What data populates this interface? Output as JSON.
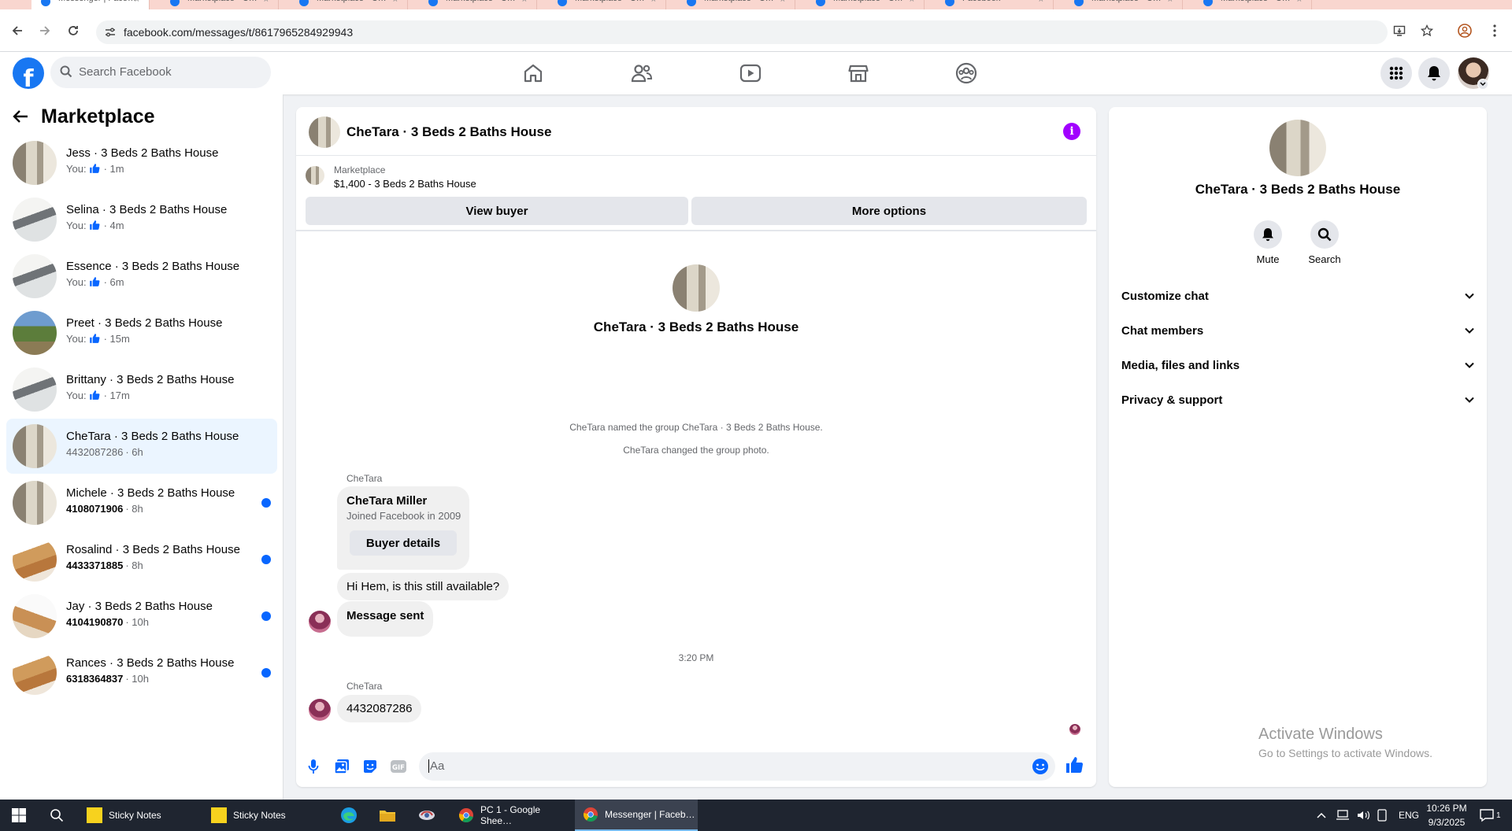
{
  "browser": {
    "tabs": [
      "Messenger | Face…",
      "Marketplace - C…",
      "Marketplace - C…",
      "Marketplace - C…",
      "Marketplace - C…",
      "Marketplace - C…",
      "Marketplace - C…",
      "Facebook",
      "Marketplace - C…",
      "Marketplace - C…"
    ],
    "url": "facebook.com/messages/t/8617965284929943"
  },
  "fb": {
    "search_placeholder": "Search Facebook",
    "brand_color": "#1877f2"
  },
  "sidebar": {
    "title": "Marketplace",
    "conversations": [
      {
        "name": "Jess · 3 Beds 2 Baths House",
        "prefix": "You:",
        "time": "· 1m",
        "liked": true,
        "unread": false,
        "active": false,
        "thumb": "thumb-a"
      },
      {
        "name": "Selina · 3 Beds 2 Baths House",
        "prefix": "You:",
        "time": "· 4m",
        "liked": true,
        "unread": false,
        "active": false,
        "thumb": "thumb-b"
      },
      {
        "name": "Essence · 3 Beds 2 Baths House",
        "prefix": "You:",
        "time": "· 6m",
        "liked": true,
        "unread": false,
        "active": false,
        "thumb": "thumb-b"
      },
      {
        "name": "Preet · 3 Beds 2 Baths House",
        "prefix": "You:",
        "time": "· 15m",
        "liked": true,
        "unread": false,
        "active": false,
        "thumb": "thumb-c"
      },
      {
        "name": "Brittany · 3 Beds 2 Baths House",
        "prefix": "You:",
        "time": "· 17m",
        "liked": true,
        "unread": false,
        "active": false,
        "thumb": "thumb-b"
      },
      {
        "name": "CheTara · 3 Beds 2 Baths House",
        "prefix": "4432087286",
        "time": "· 6h",
        "liked": false,
        "unread": false,
        "active": true,
        "thumb": "thumb-a"
      },
      {
        "name": "Michele · 3 Beds 2 Baths House",
        "prefix": "4108071906",
        "time": "· 8h",
        "liked": false,
        "unread": true,
        "active": false,
        "thumb": "thumb-a"
      },
      {
        "name": "Rosalind · 3 Beds 2 Baths House",
        "prefix": "4433371885",
        "time": "· 8h",
        "liked": false,
        "unread": true,
        "active": false,
        "thumb": "thumb-d"
      },
      {
        "name": "Jay · 3 Beds 2 Baths House",
        "prefix": "4104190870",
        "time": "· 10h",
        "liked": false,
        "unread": true,
        "active": false,
        "thumb": "thumb-e"
      },
      {
        "name": "Rances · 3 Beds 2 Baths House",
        "prefix": "6318364837",
        "time": "· 10h",
        "liked": false,
        "unread": true,
        "active": false,
        "thumb": "thumb-d"
      }
    ]
  },
  "chat": {
    "title": "CheTara · 3 Beds 2 Baths House",
    "listing_source": "Marketplace",
    "listing_title": "$1,400 - 3 Beds 2 Baths House",
    "view_buyer_label": "View buyer",
    "more_options_label": "More options",
    "hero_name": "CheTara · 3 Beds 2 Baths House",
    "system_messages": [
      "CheTara named the group CheTara · 3 Beds 2 Baths House.",
      "CheTara changed the group photo."
    ],
    "sender_1": "CheTara",
    "card_name": "CheTara Miller",
    "card_sub": "Joined Facebook in 2009",
    "card_button": "Buyer details",
    "msg_1": "Hi Hem, is this still available?",
    "msg_2": "Message sent",
    "timestamp": "3:20 PM",
    "sender_2": "CheTara",
    "msg_3": "4432087286",
    "composer_placeholder": "Aa"
  },
  "right_panel": {
    "name": "CheTara · 3 Beds 2 Baths House",
    "mute_label": "Mute",
    "search_label": "Search",
    "sections": [
      "Customize chat",
      "Chat members",
      "Media, files and links",
      "Privacy & support"
    ],
    "watermark_title": "Activate Windows",
    "watermark_sub": "Go to Settings to activate Windows."
  },
  "taskbar": {
    "apps": [
      "Sticky Notes",
      "Sticky Notes",
      "PC 1 - Google Shee…",
      "Messenger | Faceb…"
    ],
    "lang": "ENG",
    "time": "10:26 PM",
    "date": "9/3/2025",
    "notif_count": "1"
  }
}
